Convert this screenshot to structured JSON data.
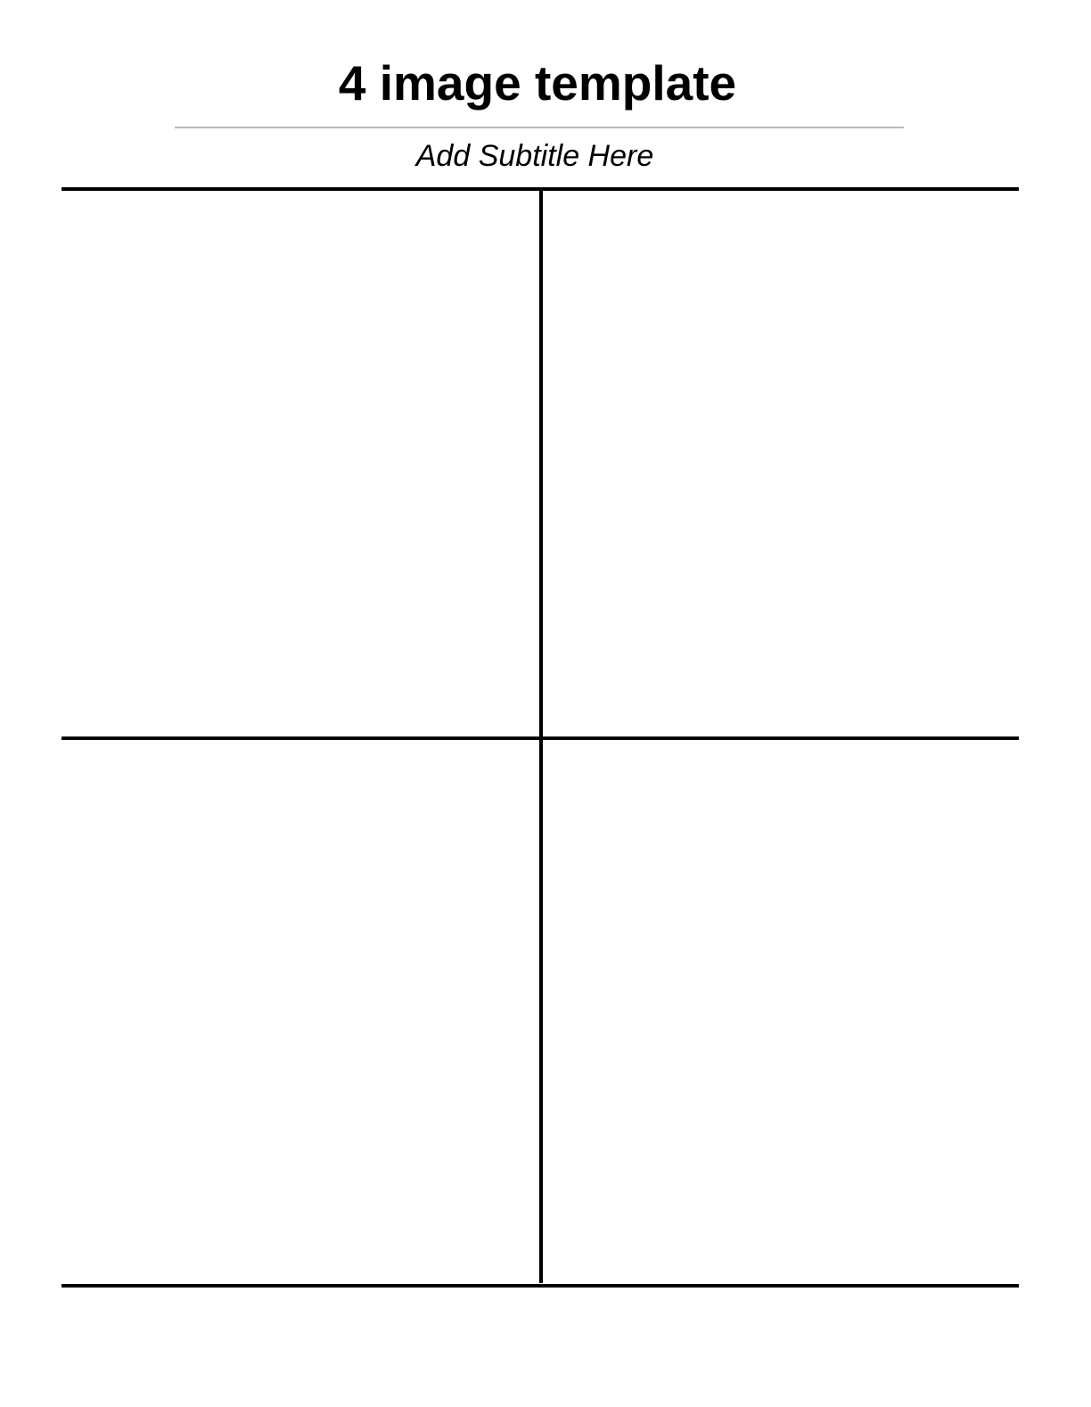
{
  "document": {
    "title": "4 image template",
    "subtitle": "Add Subtitle Here"
  },
  "grid": {
    "rows": 2,
    "columns": 2,
    "cells": [
      "",
      "",
      "",
      ""
    ]
  },
  "colors": {
    "text": "#000000",
    "rule": "#b8b8b8",
    "grid_lines": "#000000",
    "background": "#ffffff"
  }
}
